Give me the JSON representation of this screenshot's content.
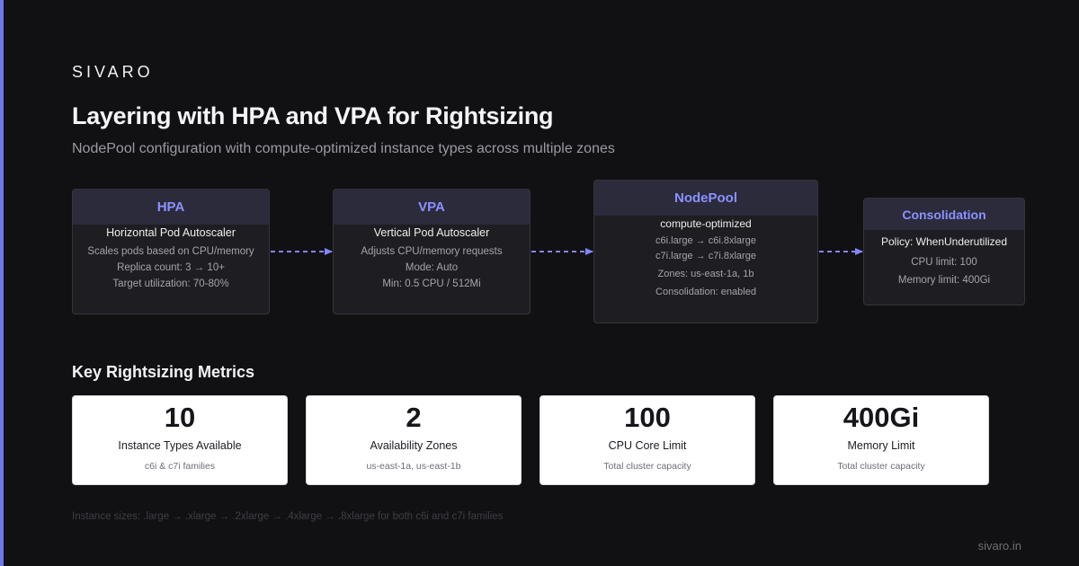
{
  "brand": "SIVARO",
  "title": "Layering with HPA and VPA for Rightsizing",
  "subtitle": "NodePool configuration with compute-optimized instance types across multiple zones",
  "colors": {
    "accent": "#6f78e6",
    "card_header_text": "#8b91ff",
    "arrow": "#7f86ff"
  },
  "flow": {
    "hpa": {
      "header": "HPA",
      "subtitle": "Horizontal Pod Autoscaler",
      "lines": [
        "Scales pods based on CPU/memory",
        "Replica count: 3 → 10+",
        "Target utilization: 70-80%"
      ]
    },
    "vpa": {
      "header": "VPA",
      "subtitle": "Vertical Pod Autoscaler",
      "lines": [
        "Adjusts CPU/memory requests",
        "Mode: Auto",
        "Min: 0.5 CPU / 512Mi"
      ]
    },
    "nodepool": {
      "header": "NodePool",
      "subtitle": "compute-optimized",
      "lines": [
        "c6i.large → c6i.8xlarge",
        "c7i.large → c7i.8xlarge",
        "Zones: us-east-1a, 1b",
        "Consolidation: enabled"
      ]
    },
    "consolidation": {
      "header": "Consolidation",
      "subtitle": "Policy: WhenUnderutilized",
      "lines": [
        "CPU limit: 100",
        "Memory limit: 400Gi"
      ]
    }
  },
  "metrics_title": "Key Rightsizing Metrics",
  "metrics": [
    {
      "value": "10",
      "label": "Instance Types Available",
      "note": "c6i & c7i families"
    },
    {
      "value": "2",
      "label": "Availability Zones",
      "note": "us-east-1a, us-east-1b"
    },
    {
      "value": "100",
      "label": "CPU Core Limit",
      "note": "Total cluster capacity"
    },
    {
      "value": "400Gi",
      "label": "Memory Limit",
      "note": "Total cluster capacity"
    }
  ],
  "footnote": "Instance sizes: .large → .xlarge → .2xlarge → .4xlarge → .8xlarge for both c6i and c7i families",
  "site": "sivaro.in"
}
